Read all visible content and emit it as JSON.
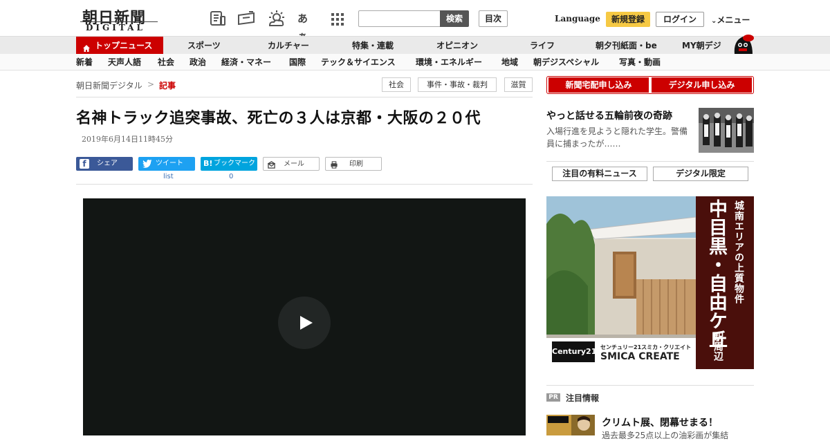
{
  "header": {
    "logo_main": "朝日新聞",
    "logo_sub": "DIGITAL",
    "search_button": "検索",
    "search_placeholder": "",
    "toc_button": "目次",
    "language": "Language",
    "signup": "新規登録",
    "login": "ログイン",
    "menu": "メニュー",
    "icons": [
      "newspaper-icon",
      "ticket-icon",
      "weather-icon",
      "font-size-icon",
      "apps-grid-icon"
    ],
    "font_icon_text": "あぁ"
  },
  "nav_primary": {
    "active": "トップニュース",
    "items": [
      "スポーツ",
      "カルチャー",
      "特集・連載",
      "オピニオン",
      "ライフ",
      "朝夕刊紙面・be",
      "MY朝デジ"
    ]
  },
  "nav_secondary": {
    "items": [
      "新着",
      "天声人語",
      "社会",
      "政治",
      "経済・マネー",
      "国際",
      "テック＆サイエンス",
      "環境・エネルギー",
      "地域",
      "朝デジスペシャル",
      "写真・動画"
    ]
  },
  "breadcrumb": {
    "home": "朝日新聞デジタル",
    "separator": ">",
    "current": "記事"
  },
  "tags": [
    "社会",
    "事件・事故・裁判",
    "滋賀"
  ],
  "article": {
    "headline": "名神トラック追突事故、死亡の３人は京都・大阪の２０代",
    "date": "2019年6月14日11時45分",
    "share": {
      "facebook": "シェア",
      "twitter": "ツイート",
      "hatena": "ブックマーク",
      "hatena_mark": "B!",
      "mail": "メール",
      "print": "印刷",
      "twitter_count": "list",
      "hatena_count": "0"
    }
  },
  "sidebar": {
    "subscribe_paper": "新聞宅配申し込み",
    "subscribe_digital": "デジタル申し込み",
    "feature_title": "やっと話せる五輪前夜の奇跡",
    "feature_desc": "入場行進を見ようと隠れた学生。警備員に捕まったが……",
    "tab_paid": "注目の有料ニュース",
    "tab_digital": "デジタル限定",
    "ad": {
      "headline_small": "城南エリアの上質物件",
      "headline_big": "中目黒・自由ケ丘",
      "headline_tail": "駅周辺",
      "brand_logo": "Century21",
      "brand_name_jp": "センチュリー21スミカ・クリエイト",
      "brand_name_en": "SMICA CREATE"
    },
    "pr_badge": "PR",
    "pr_label": "注目情報",
    "pr_title": "クリムト展、閉幕せまる！",
    "pr_desc": "過去最多25点以上の油彩画が集結"
  },
  "colors": {
    "accent_red": "#cc0000",
    "signup_yellow": "#f6c944",
    "facebook_blue": "#3b5998",
    "twitter_blue": "#1da1f2",
    "hatena_blue": "#00a4de"
  }
}
